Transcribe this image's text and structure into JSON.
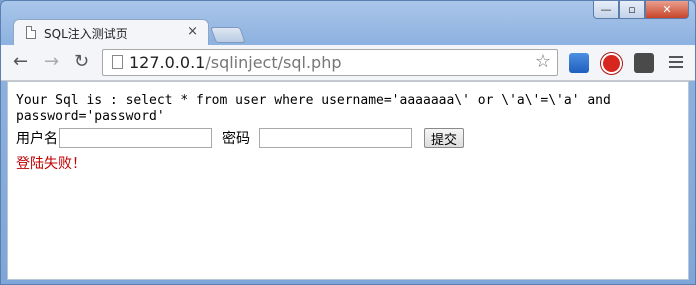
{
  "tab": {
    "title": "SQL注入测试页",
    "close_glyph": "×"
  },
  "window_controls": {
    "minimize": "—",
    "maximize": "▫",
    "close": "✕"
  },
  "toolbar": {
    "back": "←",
    "forward": "→",
    "reload": "↻",
    "url_host": "127.0.0.1",
    "url_path": "/sqlinject/sql.php",
    "star": "☆"
  },
  "page": {
    "sql_text": "Your Sql is : select * from user where username='aaaaaaa\\' or \\'a\\'=\\'a' and password='password'",
    "username_label": "用户名",
    "username_value": "",
    "password_label": "密码",
    "password_value": "",
    "submit_label": "提交",
    "message": "登陆失败！"
  },
  "colors": {
    "message": "#c00000",
    "ext_1": "#2a6fd2",
    "ext_2": "#d7261e",
    "ext_3": "#4a4a4a"
  }
}
